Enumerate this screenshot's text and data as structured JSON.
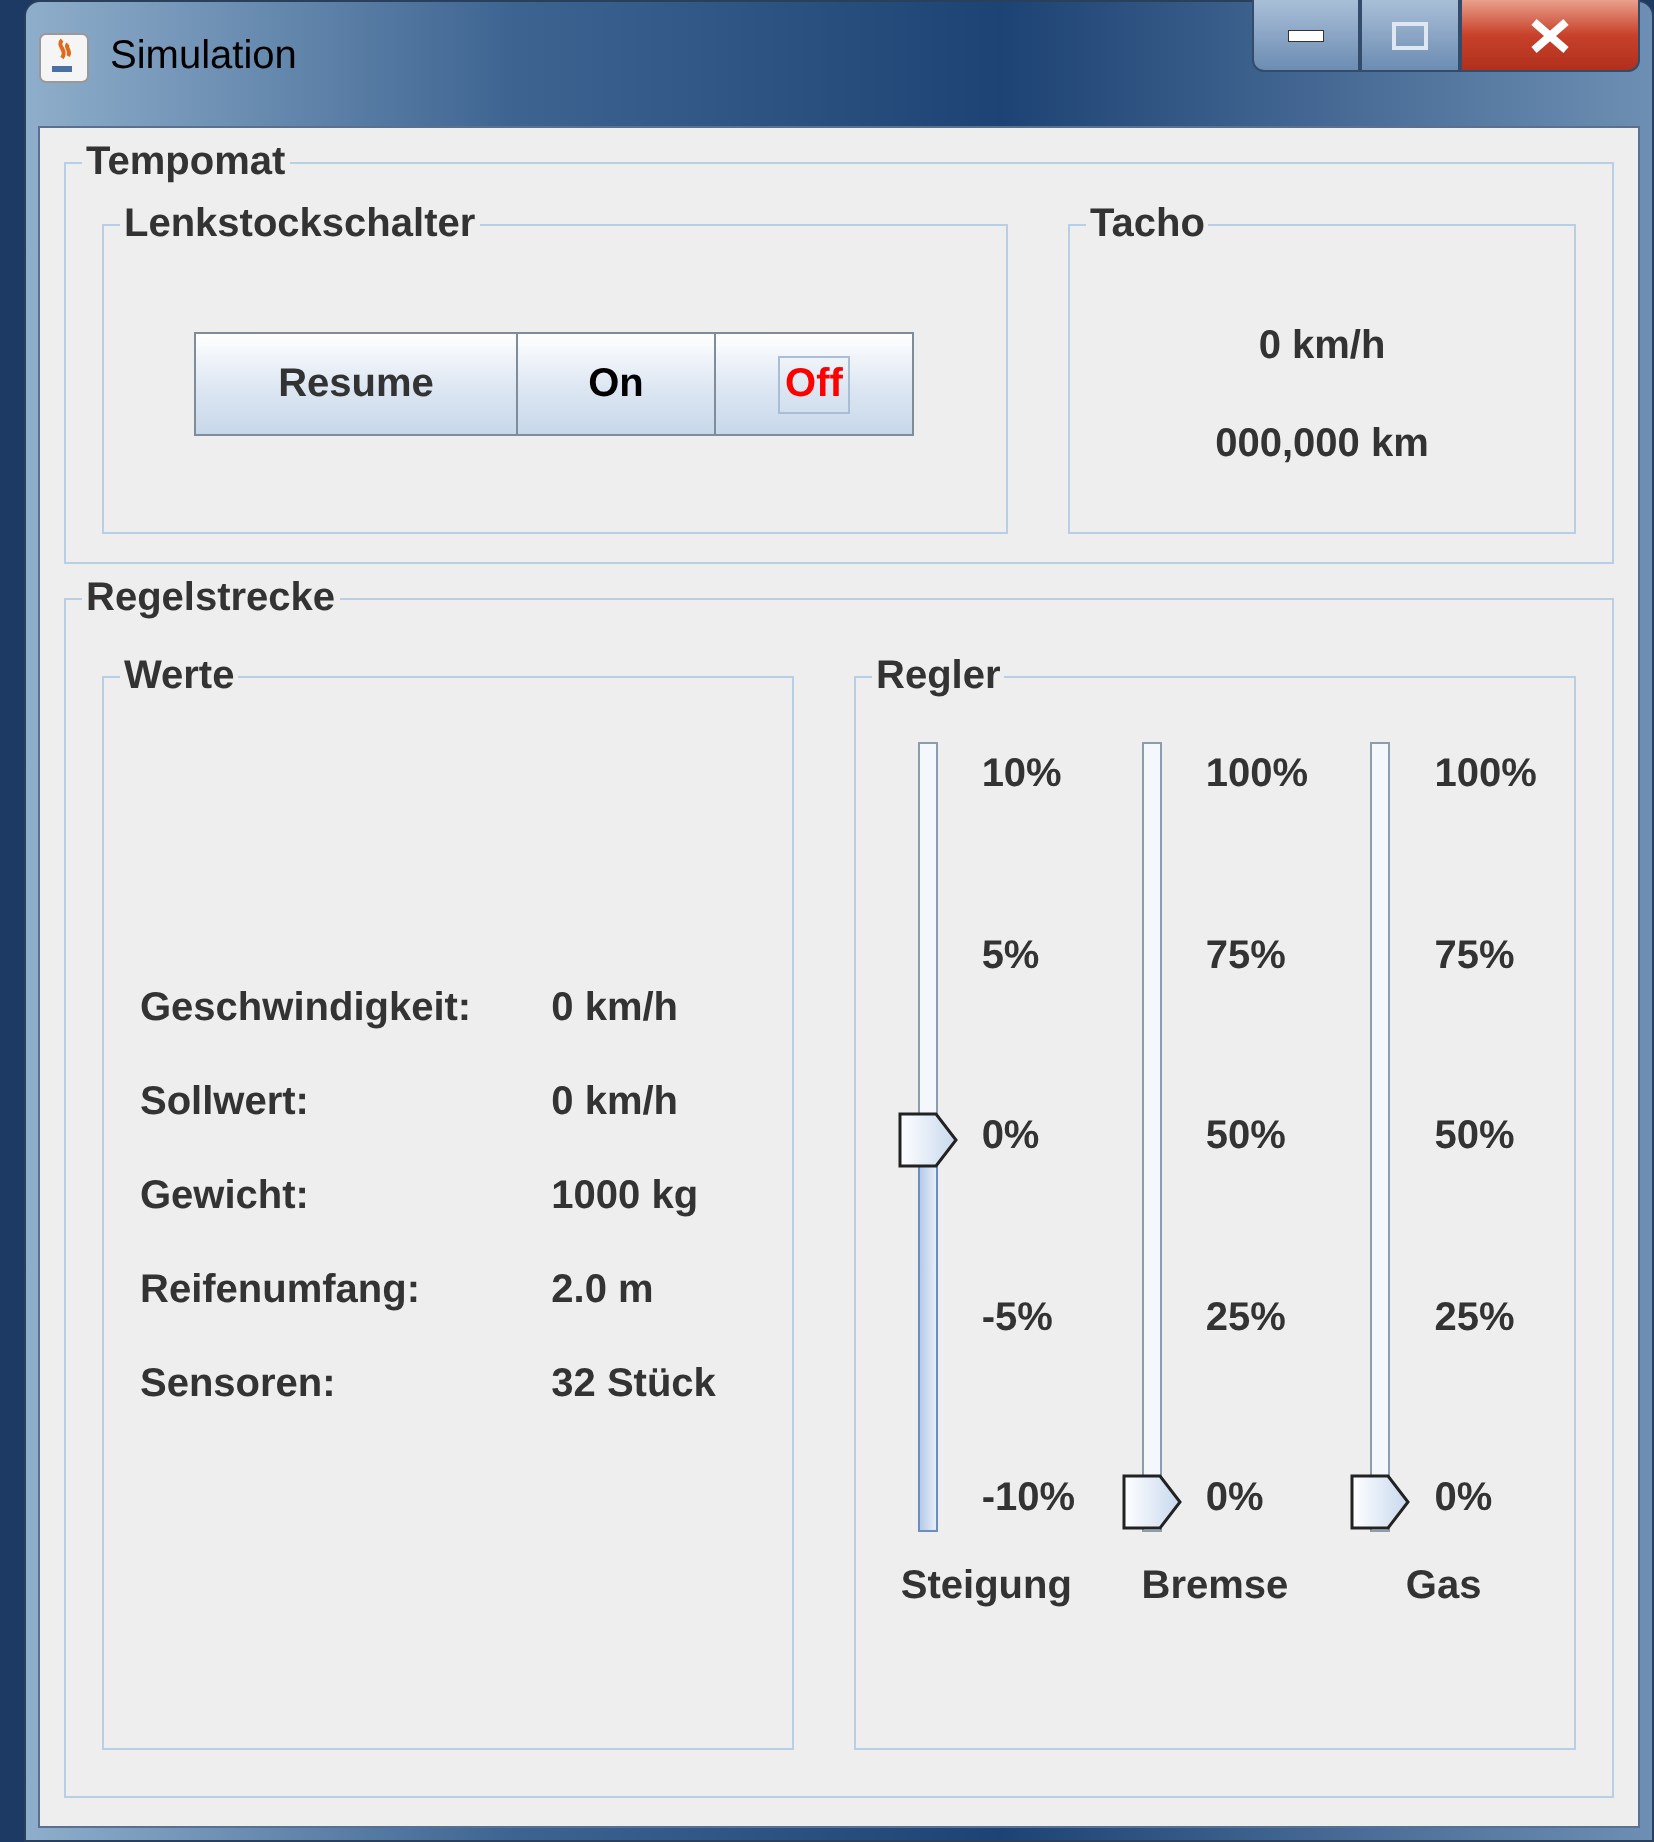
{
  "window": {
    "title": "Simulation"
  },
  "tempomat": {
    "title": "Tempomat",
    "switch": {
      "title": "Lenkstockschalter",
      "buttons": [
        {
          "label": "Resume",
          "color": "#333333",
          "focused": false
        },
        {
          "label": "On",
          "color": "#000000",
          "focused": false
        },
        {
          "label": "Off",
          "color": "#ff0000",
          "focused": true
        }
      ]
    },
    "tacho": {
      "title": "Tacho",
      "speed": "0 km/h",
      "odometer": "000,000 km"
    }
  },
  "regelstrecke": {
    "title": "Regelstrecke",
    "werte": {
      "title": "Werte",
      "rows": [
        {
          "label": "Geschwindigkeit:",
          "value": "0 km/h"
        },
        {
          "label": "Sollwert:",
          "value": "0 km/h"
        },
        {
          "label": "Gewicht:",
          "value": "1000 kg"
        },
        {
          "label": "Reifenumfang:",
          "value": "2.0 m"
        },
        {
          "label": "Sensoren:",
          "value": "32 Stück"
        }
      ]
    },
    "regler": {
      "title": "Regler",
      "sliders": [
        {
          "name": "Steigung",
          "level": 0.5,
          "ticks": [
            "10%",
            "5%",
            "0%",
            "-5%",
            "-10%"
          ]
        },
        {
          "name": "Bremse",
          "level": 0,
          "ticks": [
            "100%",
            "75%",
            "50%",
            "25%",
            "0%"
          ]
        },
        {
          "name": "Gas",
          "level": 0,
          "ticks": [
            "100%",
            "75%",
            "50%",
            "25%",
            "0%"
          ]
        }
      ]
    }
  }
}
